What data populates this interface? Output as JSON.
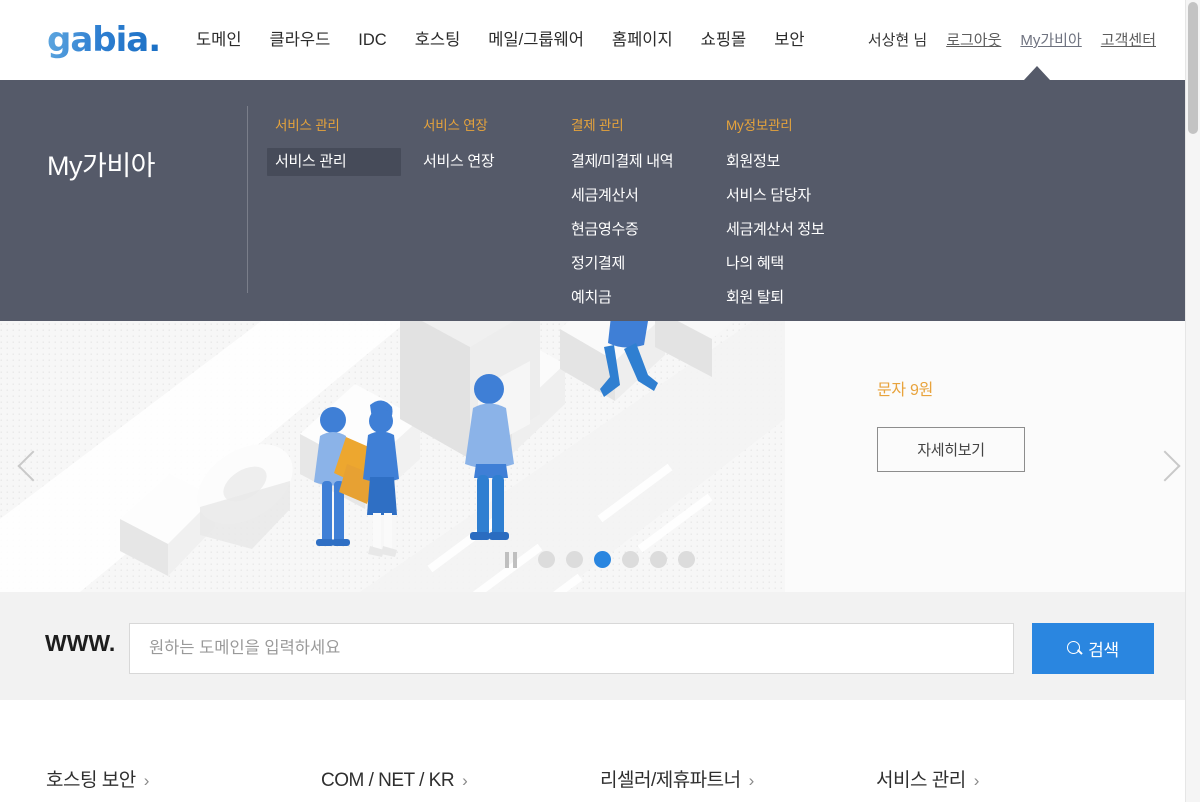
{
  "header": {
    "logo_text": "gabia.",
    "nav": [
      {
        "label": "도메인"
      },
      {
        "label": "클라우드"
      },
      {
        "label": "IDC"
      },
      {
        "label": "호스팅"
      },
      {
        "label": "메일/그룹웨어"
      },
      {
        "label": "홈페이지"
      },
      {
        "label": "쇼핑몰"
      },
      {
        "label": "보안"
      }
    ],
    "util": [
      {
        "label": "서상현 님"
      },
      {
        "label": "로그아웃"
      },
      {
        "label": "My가비아"
      },
      {
        "label": "고객센터"
      }
    ]
  },
  "mega_menu": {
    "title": "My가비아",
    "columns": [
      {
        "head": "서비스 관리",
        "items": [
          {
            "label": "서비스 관리",
            "selected": true
          }
        ]
      },
      {
        "head": "서비스 연장",
        "items": [
          {
            "label": "서비스 연장",
            "selected": false
          }
        ]
      },
      {
        "head": "결제 관리",
        "items": [
          {
            "label": "결제/미결제 내역",
            "selected": false
          },
          {
            "label": "세금계산서",
            "selected": false
          },
          {
            "label": "현금영수증",
            "selected": false
          },
          {
            "label": "정기결제",
            "selected": false
          },
          {
            "label": "예치금",
            "selected": false
          }
        ]
      },
      {
        "head": "My정보관리",
        "items": [
          {
            "label": "회원정보",
            "selected": false
          },
          {
            "label": "서비스 담당자",
            "selected": false
          },
          {
            "label": "세금계산서 정보",
            "selected": false
          },
          {
            "label": "나의 혜택",
            "selected": false
          },
          {
            "label": "회원 탈퇴",
            "selected": false
          }
        ]
      }
    ],
    "colors": {
      "panel": "#555a69",
      "head_text": "#e5a33c",
      "selected_bg": "#464b59"
    }
  },
  "hero": {
    "promo_text": "문자 9원",
    "cta_label": "자세히보기",
    "illustration_alt": "COM NET isometric city illustration",
    "carousel": {
      "pause_label": "pause",
      "total_slides": 6,
      "active_slide": 3
    }
  },
  "search": {
    "prefix_label": "WWW.",
    "placeholder": "원하는 도메인을 입력하세요",
    "value": "",
    "button_label": "검색",
    "button_color": "#2a86e0"
  },
  "quick_links": [
    {
      "label": "호스팅 보안",
      "chevron": "›"
    },
    {
      "label": "COM / NET / KR",
      "chevron": "›"
    },
    {
      "label": "리셀러/제휴파트너",
      "chevron": "›"
    },
    {
      "label": "서비스 관리",
      "chevron": "›"
    }
  ]
}
